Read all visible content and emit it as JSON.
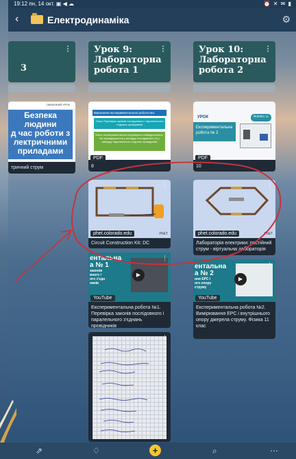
{
  "statusbar": {
    "time": "19:12",
    "date": "пн, 14 окт.",
    "icons": "▣ ◀ ☁",
    "sys": "⏰ ✕ ✉ ▮"
  },
  "appbar": {
    "title": "Електродинаміка"
  },
  "columns": [
    {
      "title": "3"
    },
    {
      "title": "Урок 9: Лабораторна робота 1"
    },
    {
      "title": "Урок 10: Лабораторна робота 2"
    }
  ],
  "cards": {
    "col0": {
      "thumb_lines": [
        "Безпека",
        "людини",
        "д час роботи з",
        "лектричними",
        "приладами"
      ],
      "thumb_top": "ОКНИЧНИЙ УРОК",
      "caption": "тричний струм"
    },
    "col1_pdf": {
      "head": "Виконання експериментальної роботи №1",
      "topic": "Тема: Перевірка законів послідовного і паралельного з'єднань провідників",
      "goal": "Мета: експериментально перевірити співвідношення, які справджуються у випадку послідовного та у випадку паралельного з'єднань провідників",
      "tag": "PDF",
      "caption": "8"
    },
    "col2_pdf": {
      "head": "УРОК",
      "badge": "ФІЗИКА 11",
      "line1": "Експериментальна",
      "line2": "робота № 2",
      "tag": "PDF",
      "caption": "10"
    },
    "col1_phet": {
      "tag": "phet.colorado.edu",
      "mini": "PhET",
      "caption": "Circuit Construction Kit: DC"
    },
    "col2_phet": {
      "tag": "phet.colorado.edu",
      "mini": "PhET",
      "caption": "Лабораторія електрики: постійний струм - віртуальна лабораторія"
    },
    "col1_yt": {
      "title_lines": [
        "ентальна",
        "а № 1",
        "законів",
        "вного і",
        "ого з'єдн",
        "ників"
      ],
      "tag": "YouTube",
      "caption": "Експериментальна робота №1. Перевірка законів послідовного і паралельного з'єднань провідників"
    },
    "col2_yt": {
      "title_lines": [
        "ентальна",
        "а № 2",
        "ння ЕРС і",
        "ого опору",
        "струму"
      ],
      "tag": "YouTube",
      "caption": "Експериментальна робота №2. Вимірювання ЕРС і внутрішнього опору джерела струму. Фізика 11 клас"
    },
    "col1_photo": {
      "caption": "handwritten notebook page"
    }
  },
  "colors": {
    "header": "#243f5a",
    "column": "#2a5a5e",
    "card": "#1f2a36",
    "annotation": "#c8323a",
    "fab": "#f3c631"
  },
  "icons": {
    "back": "back-icon",
    "folder": "folder-icon",
    "gear": "gear-icon",
    "share": "share-icon",
    "bell": "bell-icon",
    "plus": "plus-icon",
    "search": "search-icon",
    "more": "more-icon"
  }
}
